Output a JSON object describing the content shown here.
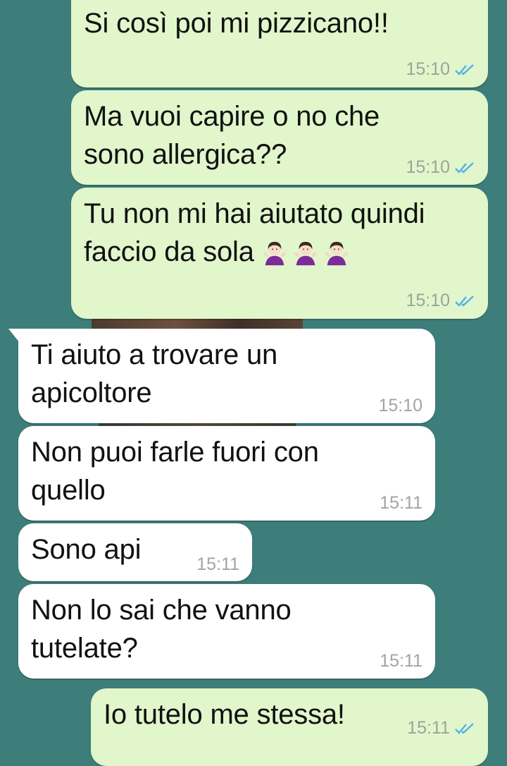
{
  "conversation": {
    "messages": [
      {
        "direction": "outgoing",
        "text": "Si così poi mi pizzicano!!",
        "time": "15:10",
        "status": "read"
      },
      {
        "direction": "outgoing",
        "text": "Ma vuoi capire o no che\nsono allergica??",
        "time": "15:10",
        "status": "read"
      },
      {
        "direction": "outgoing",
        "text": "Tu non mi hai aiutato quindi\nfaccio da sola",
        "emoji": "woman-shrugging-icon",
        "emoji_count": 3,
        "time": "15:10",
        "status": "read"
      },
      {
        "direction": "incoming",
        "text": "Ti aiuto a trovare un\napicoltore",
        "time": "15:10"
      },
      {
        "direction": "incoming",
        "text": "Non puoi farle fuori con\nquello",
        "time": "15:11"
      },
      {
        "direction": "incoming",
        "text": "Sono api",
        "time": "15:11"
      },
      {
        "direction": "incoming",
        "text": "Non lo sai che vanno\ntutelate?",
        "time": "15:11"
      },
      {
        "direction": "outgoing",
        "text": "Io tutelo me stessa!",
        "time": "15:11",
        "status": "read"
      }
    ]
  },
  "colors": {
    "background": "#3d7d7a",
    "outgoing_bubble": "#e1f6cb",
    "incoming_bubble": "#ffffff",
    "read_ticks": "#4fb3e8"
  }
}
